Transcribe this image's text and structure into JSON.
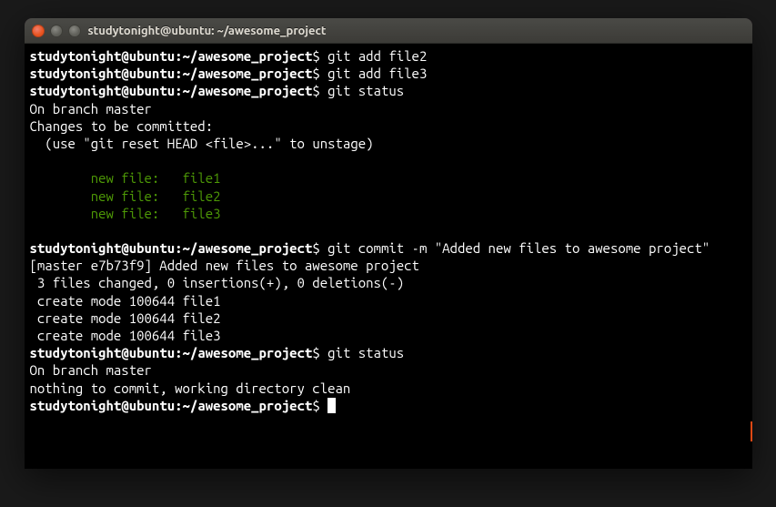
{
  "window": {
    "title": "studytonight@ubuntu: ~/awesome_project"
  },
  "prompt": {
    "user": "studytonight",
    "host": "ubuntu",
    "path": "~/awesome_project",
    "sep_userhost": "@",
    "sep_colon": ":",
    "dollar": "$"
  },
  "lines": {
    "cmd1": "git add file2",
    "cmd2": "git add file3",
    "cmd3": "git status",
    "branch": "On branch master",
    "changes_hdr": "Changes to be committed:",
    "unstage_hint": "  (use \"git reset HEAD <file>...\" to unstage)",
    "nf1": "        new file:   file1",
    "nf2": "        new file:   file2",
    "nf3": "        new file:   file3",
    "cmd4": "git commit -m \"Added new files to awesome project\"",
    "commit_out1": "[master e7b73f9] Added new files to awesome project",
    "commit_out2": " 3 files changed, 0 insertions(+), 0 deletions(-)",
    "commit_out3": " create mode 100644 file1",
    "commit_out4": " create mode 100644 file2",
    "commit_out5": " create mode 100644 file3",
    "cmd5": "git status",
    "branch2": "On branch master",
    "clean": "nothing to commit, working directory clean"
  }
}
